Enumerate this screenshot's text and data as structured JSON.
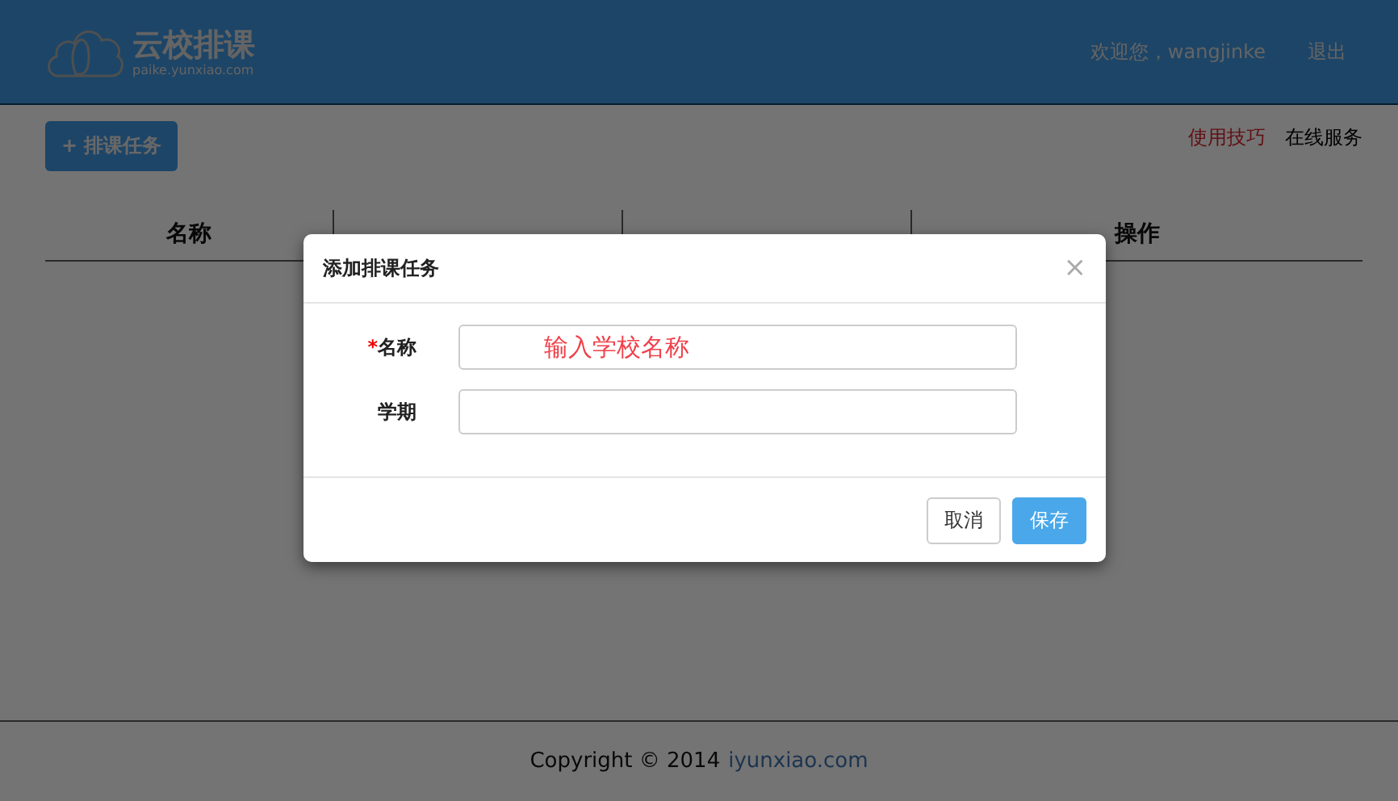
{
  "header": {
    "logo_title": "云校排课",
    "logo_subtitle": "paike.yunxiao.com",
    "welcome": "欢迎您，wangjinke",
    "logout": "退出"
  },
  "toolbar": {
    "add_button": "+ 排课任务",
    "links": [
      {
        "label": "使用技巧",
        "kind": "highlight"
      },
      {
        "label": "在线服务",
        "kind": "plain"
      }
    ]
  },
  "table": {
    "columns": [
      "名称",
      "操作"
    ]
  },
  "dialog": {
    "title": "添加排课任务",
    "close": "×",
    "fields": [
      {
        "label": "名称",
        "required": true,
        "value": "输入学校名称"
      },
      {
        "label": "学期",
        "required": false
      }
    ],
    "required_mark": "*",
    "buttons": [
      {
        "label": "取消",
        "kind": "default"
      },
      {
        "label": "保存",
        "kind": "primary"
      }
    ]
  },
  "footer": {
    "text": "Copyright © 2014",
    "link": "iyunxiao.com"
  }
}
